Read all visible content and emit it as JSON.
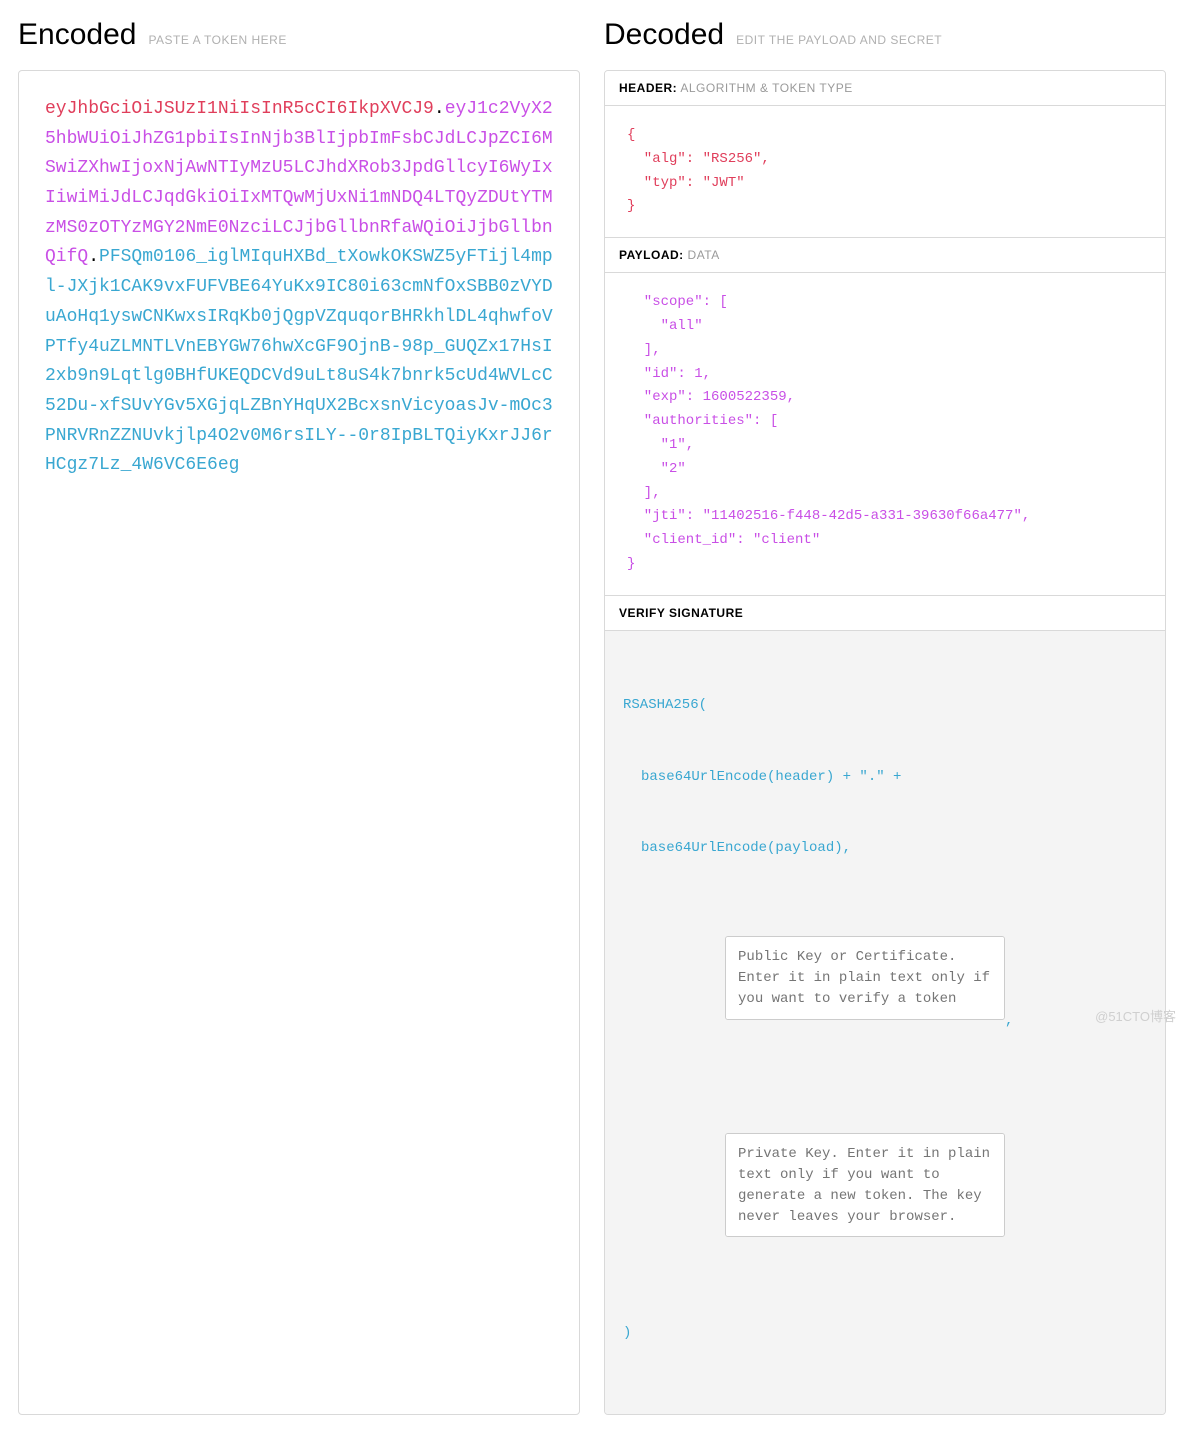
{
  "encoded": {
    "title": "Encoded",
    "subtitle": "PASTE A TOKEN HERE",
    "header": "eyJhbGciOiJSUzI1NiIsInR5cCI6IkpXVCJ9",
    "payload": "eyJ1c2VyX25hbWUiOiJhZG1pbiIsInNjb3BlIjpbImFsbCJdLCJpZCI6MSwiZXhwIjoxNjAwNTIyMzU5LCJhdXRob3JpdGllcyI6WyIxIiwiMiJdLCJqdGkiOiIxMTQwMjUxNi1mNDQ4LTQyZDUtYTMzMS0zOTYzMGY2NmE0NzciLCJjbGllbnRfaWQiOiJjbGllbnQifQ",
    "signature": "PFSQm0106_iglMIquHXBd_tXowkOKSWZ5yFTijl4mpl-JXjk1CAK9vxFUFVBE64YuKx9IC80i63cmNfOxSBB0zVYDuAoHq1yswCNKwxsIRqKb0jQgpVZquqorBHRkhlDL4qhwfoVPTfy4uZLMNTLVnEBYGW76hwXcGF9OjnB-98p_GUQZx17HsI2xb9n9Lqtlg0BHfUKEQDCVd9uLt8uS4k7bnrk5cUd4WVLcC52Du-xfSUvYGv5XGjqLZBnYHqUX2BcxsnVicyoasJv-mOc3PNRVRnZZNUvkjlp4O2v0M6rsILY--0r8IpBLTQiyKxrJJ6rHCgz7Lz_4W6VC6E6eg"
  },
  "decoded": {
    "title": "Decoded",
    "subtitle": "EDIT THE PAYLOAD AND SECRET",
    "header_section": {
      "label": "HEADER:",
      "sublabel": "ALGORITHM & TOKEN TYPE"
    },
    "header_json": "{\n  \"alg\": \"RS256\",\n  \"typ\": \"JWT\"\n}",
    "payload_section": {
      "label": "PAYLOAD:",
      "sublabel": "DATA"
    },
    "payload_json": "  \"scope\": [\n    \"all\"\n  ],\n  \"id\": 1,\n  \"exp\": 1600522359,\n  \"authorities\": [\n    \"1\",\n    \"2\"\n  ],\n  \"jti\": \"11402516-f448-42d5-a331-39630f66a477\",\n  \"client_id\": \"client\"\n}",
    "signature_section": {
      "label": "VERIFY SIGNATURE"
    },
    "sig_algo": "RSASHA256(",
    "sig_line1": "base64UrlEncode(header) + \".\" +",
    "sig_line2": "base64UrlEncode(payload),",
    "public_key_placeholder": "Public Key or Certificate. Enter it in plain text only if you want to verify a token",
    "private_key_placeholder": "Private Key. Enter it in plain text only if you want to generate a new token. The key never leaves your browser.",
    "sig_close": ")"
  },
  "watermark": "@51CTO博客"
}
